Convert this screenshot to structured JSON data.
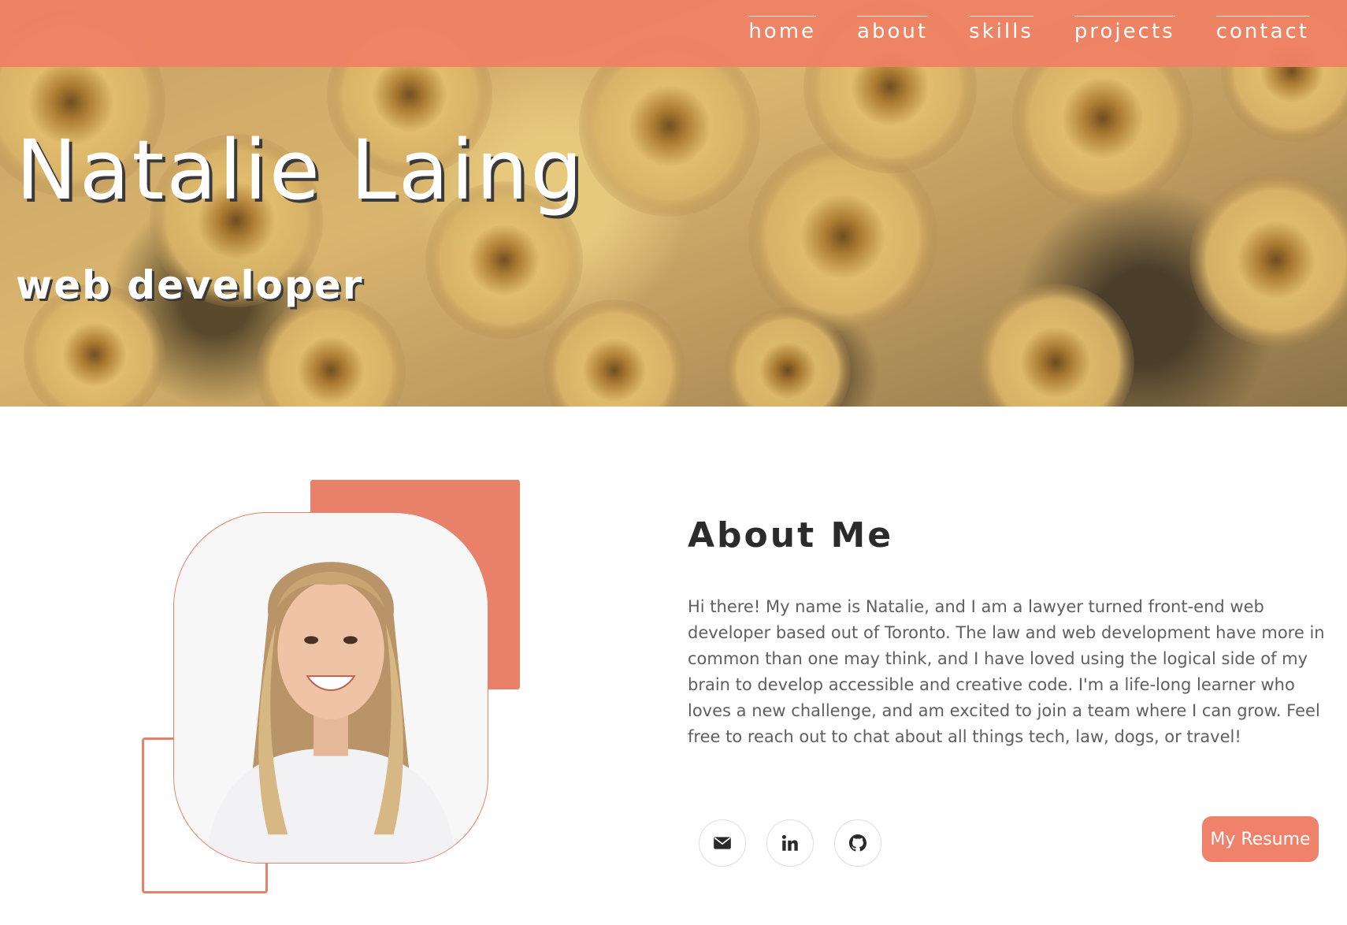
{
  "nav": {
    "items": [
      {
        "label": "home"
      },
      {
        "label": "about"
      },
      {
        "label": "skills"
      },
      {
        "label": "projects"
      },
      {
        "label": "contact"
      }
    ]
  },
  "hero": {
    "name": "Natalie Laing",
    "role": "web developer"
  },
  "about": {
    "title": "About Me",
    "text": "Hi there! My name is Natalie, and I am a lawyer turned front-end web developer based out of Toronto. The law and web development have more in common than one may think, and I have loved using the logical side of my brain to develop accessible and creative code. I'm a life-long learner who loves a new challenge, and am excited to join a team where I can grow. Feel free to reach out to chat about all things tech, law, dogs, or travel!",
    "socials": [
      {
        "icon": "envelope-icon"
      },
      {
        "icon": "linkedin-icon"
      },
      {
        "icon": "github-icon"
      }
    ],
    "resume_label": "My Resume"
  },
  "colors": {
    "accent": "#e8806a",
    "nav_band": "#f08064",
    "heading": "#2b2b2b",
    "body_text": "#5f5f5f"
  }
}
